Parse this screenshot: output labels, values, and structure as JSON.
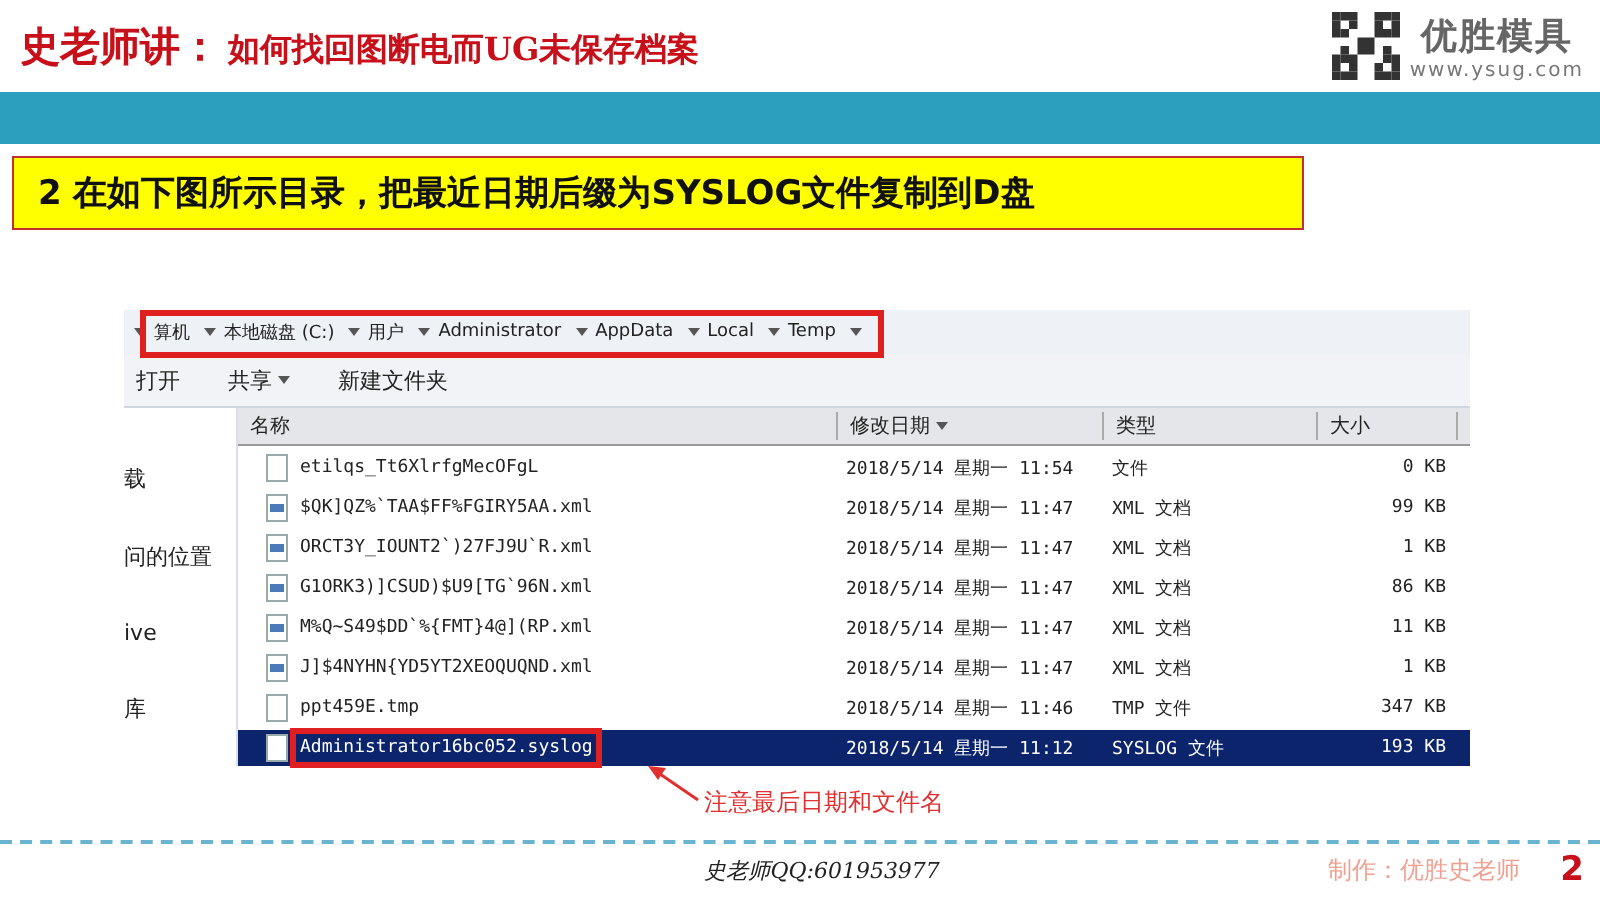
{
  "header": {
    "title_lead": "史老师讲：",
    "title": "如何找回图断电而UG未保存档案",
    "brand": "优胜模具",
    "url": "www.ysug.com"
  },
  "instruction": "2 在如下图所示目录，把最近日期后缀为SYSLOG文件复制到D盘",
  "explorer": {
    "breadcrumb": [
      "算机",
      "本地磁盘 (C:)",
      "用户",
      "Administrator",
      "AppData",
      "Local",
      "Temp"
    ],
    "toolbar": [
      {
        "label": "打开",
        "dropdown": false
      },
      {
        "label": "共享",
        "dropdown": true
      },
      {
        "label": "新建文件夹",
        "dropdown": false
      }
    ],
    "nav": [
      "载",
      "问的位置",
      "ive",
      "库"
    ],
    "columns": [
      {
        "label": "名称",
        "sorted": false
      },
      {
        "label": "修改日期",
        "sorted": true
      },
      {
        "label": "类型",
        "sorted": false
      },
      {
        "label": "大小",
        "sorted": false
      }
    ],
    "rows": [
      {
        "kind": "file",
        "name": "etilqs_Tt6XlrfgMecOFgL",
        "date": "2018/5/14 星期一 11:54",
        "type": "文件",
        "size": "0 KB",
        "selected": false,
        "marked": false
      },
      {
        "kind": "xml",
        "name": "$QK]QZ%`TAA$FF%FGIRY5AA.xml",
        "date": "2018/5/14 星期一 11:47",
        "type": "XML 文档",
        "size": "99 KB",
        "selected": false,
        "marked": false
      },
      {
        "kind": "xml",
        "name": "ORCT3Y_IOUNT2`)27FJ9U`R.xml",
        "date": "2018/5/14 星期一 11:47",
        "type": "XML 文档",
        "size": "1 KB",
        "selected": false,
        "marked": false
      },
      {
        "kind": "xml",
        "name": "G1ORK3)]CSUD)$U9[TG`96N.xml",
        "date": "2018/5/14 星期一 11:47",
        "type": "XML 文档",
        "size": "86 KB",
        "selected": false,
        "marked": false
      },
      {
        "kind": "xml",
        "name": "M%Q~S49$DD`%{FMT}4@](RP.xml",
        "date": "2018/5/14 星期一 11:47",
        "type": "XML 文档",
        "size": "11 KB",
        "selected": false,
        "marked": false
      },
      {
        "kind": "xml",
        "name": "J]$4NYHN{YD5YT2XEOQUQND.xml",
        "date": "2018/5/14 星期一 11:47",
        "type": "XML 文档",
        "size": "1 KB",
        "selected": false,
        "marked": false
      },
      {
        "kind": "file",
        "name": "ppt459E.tmp",
        "date": "2018/5/14 星期一 11:46",
        "type": "TMP 文件",
        "size": "347 KB",
        "selected": false,
        "marked": false
      },
      {
        "kind": "file",
        "name": "Administrator16bc052.syslog",
        "date": "2018/5/14 星期一 11:12",
        "type": "SYSLOG 文件",
        "size": "193 KB",
        "selected": true,
        "marked": true
      }
    ]
  },
  "annotation": "注意最后日期和文件名",
  "footer": {
    "contact": "史老师QQ:601953977",
    "credit": "制作：优胜史老师",
    "page": "2"
  }
}
